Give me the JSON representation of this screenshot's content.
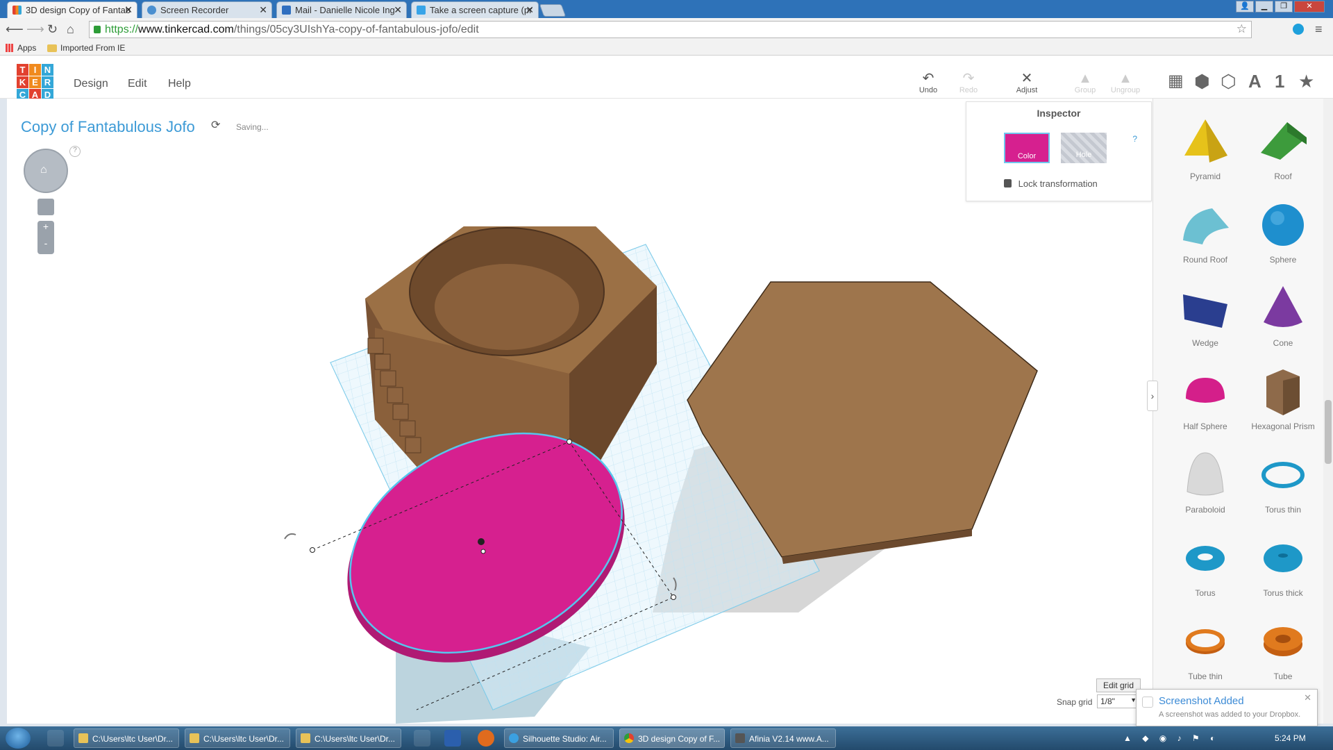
{
  "browser": {
    "tabs": [
      {
        "label": "3D design Copy of Fantab",
        "active": true,
        "icon": "tinkercad-favicon-icon"
      },
      {
        "label": "Screen Recorder",
        "active": false,
        "icon": "recorder-favicon-icon"
      },
      {
        "label": "Mail - Danielle Nicole Ing",
        "active": false,
        "icon": "mail-favicon-icon"
      },
      {
        "label": "Take a screen capture (pr",
        "active": false,
        "icon": "windows-favicon-icon"
      }
    ],
    "url_prefix": "https://",
    "url_host": "www.tinkercad.com",
    "url_path": "/things/05cy3UIshYa-copy-of-fantabulous-jofo/edit",
    "bookmarks": {
      "apps": "Apps",
      "imported": "Imported From IE"
    }
  },
  "app": {
    "logo_letters": [
      "T",
      "I",
      "N",
      "K",
      "E",
      "R",
      "C",
      "A",
      "D"
    ],
    "logo_colors": [
      "#e2412f",
      "#f08a1e",
      "#33a7d8",
      "#e2412f",
      "#f08a1e",
      "#33a7d8",
      "#33a7d8",
      "#e2412f",
      "#33a7d8"
    ],
    "menu": {
      "design": "Design",
      "edit": "Edit",
      "help": "Help"
    },
    "toolbar": {
      "undo": "Undo",
      "redo": "Redo",
      "adjust": "Adjust",
      "group": "Group",
      "ungroup": "Ungroup"
    },
    "view_letter_a": "A",
    "view_number": "1",
    "design_title": "Copy of Fantabulous Jofo",
    "saving": "Saving..."
  },
  "inspector": {
    "title": "Inspector",
    "color_label": "Color",
    "hole_label": "Hole",
    "help": "?",
    "lock_label": "Lock transformation",
    "selected_color": "#d6208f"
  },
  "shapes": [
    {
      "label": "Pyramid",
      "color": "#e6c21a"
    },
    {
      "label": "Roof",
      "color": "#3d9b3c"
    },
    {
      "label": "Round Roof",
      "color": "#6cc0d2"
    },
    {
      "label": "Sphere",
      "color": "#1e8fce"
    },
    {
      "label": "Wedge",
      "color": "#2a3e8f"
    },
    {
      "label": "Cone",
      "color": "#7b3aa0"
    },
    {
      "label": "Half Sphere",
      "color": "#d41f8a"
    },
    {
      "label": "Hexagonal Prism",
      "color": "#8e6a4a"
    },
    {
      "label": "Paraboloid",
      "color": "#d9d9d9"
    },
    {
      "label": "Torus thin",
      "color": "#1e98c8"
    },
    {
      "label": "Torus",
      "color": "#1e98c8"
    },
    {
      "label": "Torus thick",
      "color": "#1e98c8"
    },
    {
      "label": "Tube thin",
      "color": "#e07a1e"
    },
    {
      "label": "Tube",
      "color": "#e07a1e"
    }
  ],
  "grid": {
    "edit_label": "Edit grid",
    "snap_label": "Snap grid",
    "snap_value": "1/8\""
  },
  "toast": {
    "title": "Screenshot Added",
    "body": "A screenshot was added to your Dropbox."
  },
  "taskbar": {
    "items": [
      {
        "label": "C:\\Users\\ltc User\\Dr...",
        "icon": "folder-icon"
      },
      {
        "label": "C:\\Users\\ltc User\\Dr...",
        "icon": "folder-icon"
      },
      {
        "label": "C:\\Users\\ltc User\\Dr...",
        "icon": "folder-icon"
      },
      {
        "label": "Silhouette Studio: Air...",
        "icon": "silhouette-icon"
      },
      {
        "label": "3D design Copy of F...",
        "icon": "chrome-icon"
      },
      {
        "label": "Afinia  V2.14  www.A...",
        "icon": "afinia-icon"
      }
    ],
    "clock": "5:24 PM"
  }
}
